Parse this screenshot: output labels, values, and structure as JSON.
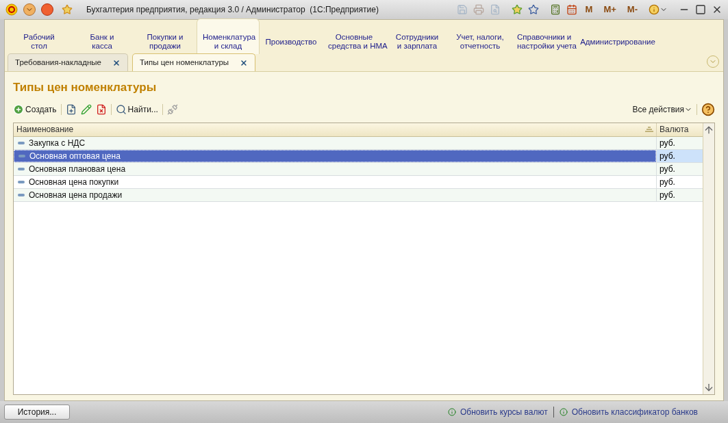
{
  "window": {
    "title": "Бухгалтерия предприятия, редакция 3.0 / Администратор  (1С:Предприятие)",
    "memory_buttons": [
      "M",
      "M+",
      "M-"
    ]
  },
  "sections": [
    {
      "label": "Рабочий\nстол",
      "selected": false
    },
    {
      "label": "Банк и\nкасса",
      "selected": false
    },
    {
      "label": "Покупки и\nпродажи",
      "selected": false
    },
    {
      "label": "Номенклатура\nи склад",
      "selected": true
    },
    {
      "label": "Производство",
      "selected": false
    },
    {
      "label": "Основные\nсредства и НМА",
      "selected": false
    },
    {
      "label": "Сотрудники\nи зарплата",
      "selected": false
    },
    {
      "label": "Учет, налоги,\nотчетность",
      "selected": false
    },
    {
      "label": "Справочники и\nнастройки учета",
      "selected": false
    },
    {
      "label": "Администрирование",
      "selected": false
    }
  ],
  "open_tabs": [
    {
      "label": "Требования-накладные",
      "selected": false
    },
    {
      "label": "Типы цен номенклатуры",
      "selected": true
    }
  ],
  "form": {
    "title": "Типы цен номенклатуры",
    "create_label": "Создать",
    "find_label": "Найти...",
    "all_actions": "Все действия"
  },
  "table": {
    "columns": [
      "Наименование",
      "Валюта"
    ],
    "rows": [
      {
        "name": "Закупка с НДС",
        "currency": "руб.",
        "selected": false
      },
      {
        "name": "Основная оптовая цена",
        "currency": "руб.",
        "selected": true
      },
      {
        "name": "Основная плановая цена",
        "currency": "руб.",
        "selected": false
      },
      {
        "name": "Основная цена покупки",
        "currency": "руб.",
        "selected": false
      },
      {
        "name": "Основная цена продажи",
        "currency": "руб.",
        "selected": false
      }
    ]
  },
  "status_bar": {
    "history_button": "История...",
    "links": [
      "Обновить курсы валют",
      "Обновить классификатор банков"
    ]
  }
}
